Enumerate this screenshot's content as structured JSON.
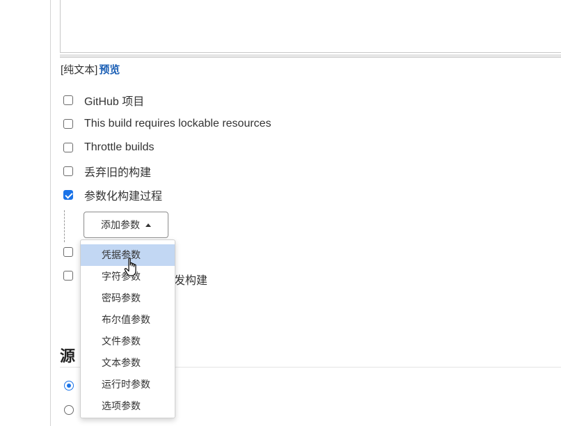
{
  "description_field": {
    "format_label": "[纯文本]",
    "preview_link": "预览"
  },
  "options": [
    {
      "label": "GitHub 项目",
      "checked": false
    },
    {
      "label": "This build requires lockable resources",
      "checked": false
    },
    {
      "label": "Throttle builds",
      "checked": false
    },
    {
      "label": "丢弃旧的构建",
      "checked": false
    },
    {
      "label": "参数化构建过程",
      "checked": true
    }
  ],
  "add_parameter_button": {
    "label": "添加参数"
  },
  "partial_hidden_option": {
    "visible_text": "发构建"
  },
  "section": {
    "title_visible": "源"
  },
  "dropdown": {
    "items": [
      {
        "label": "凭据参数",
        "highlighted": true
      },
      {
        "label": "字符参数",
        "highlighted": false
      },
      {
        "label": "密码参数",
        "highlighted": false
      },
      {
        "label": "布尔值参数",
        "highlighted": false
      },
      {
        "label": "文件参数",
        "highlighted": false
      },
      {
        "label": "文本参数",
        "highlighted": false
      },
      {
        "label": "运行时参数",
        "highlighted": false
      },
      {
        "label": "选项参数",
        "highlighted": false
      }
    ]
  },
  "colors": {
    "accent": "#1a73e8",
    "link": "#1b5fb5",
    "highlight": "#c2d7f3"
  }
}
